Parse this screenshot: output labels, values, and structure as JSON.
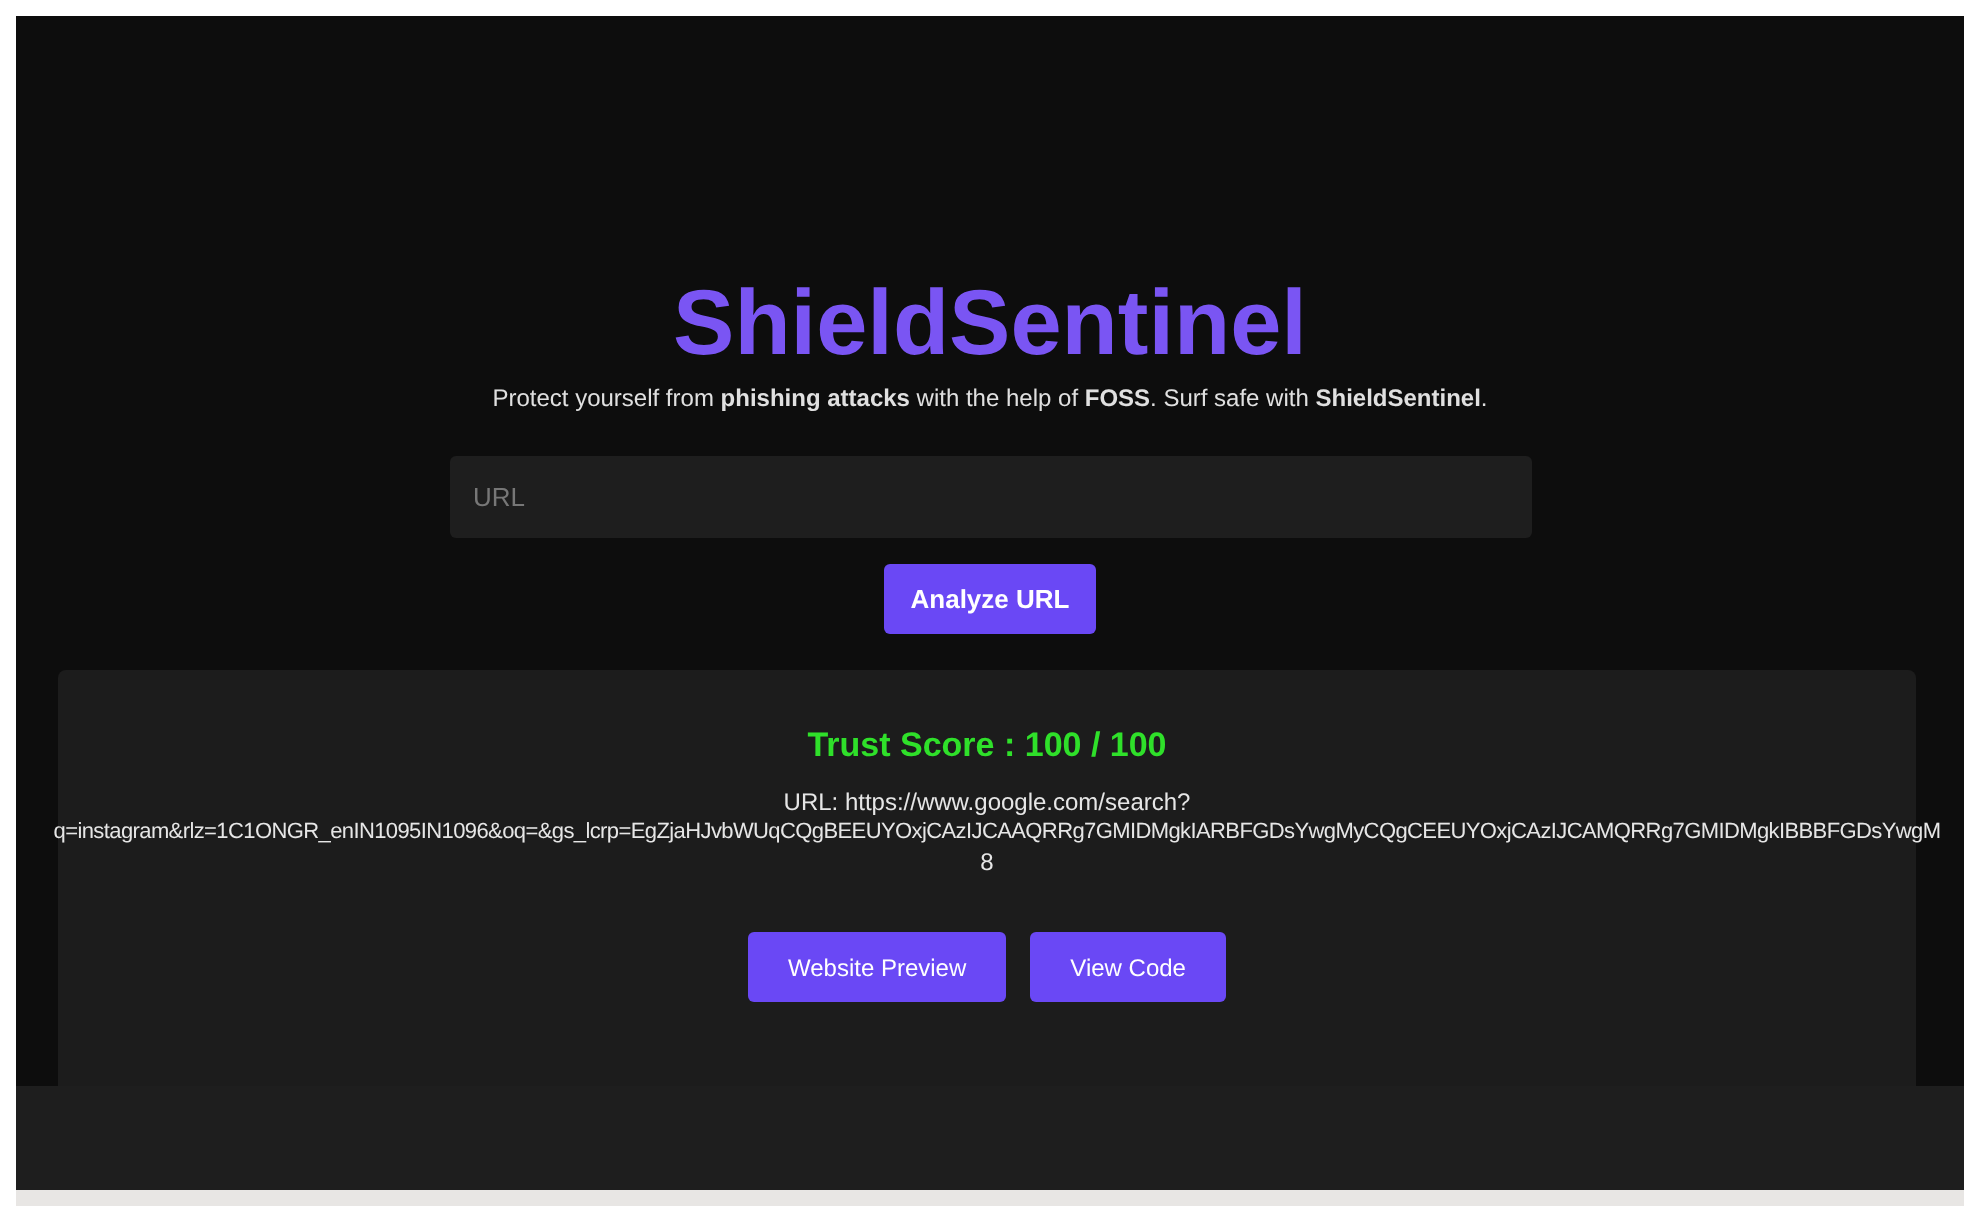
{
  "header": {
    "title": "ShieldSentinel",
    "tagline": "Protect yourself from **phishing attacks** with the help of **FOSS**. Surf safe with **ShieldSentinel**."
  },
  "search": {
    "placeholder": "URL",
    "button": "Analyze URL"
  },
  "result": {
    "score": "Trust Score : 100 / 100",
    "url_lines": [
      "URL: https://www.google.com/search?",
      "q=instagram&rlz=1C1ONGR_enIN1095IN1096&oq=&gs_lcrp=EgZjaHJvbWUqCQgBEEUYOxjCAzIJCAAQRRg7GMIDMgkIARBFGDsYwgMyCQgCEEUYOxjCAzIJCAMQRRg7GMIDMgkIBBBFGDsYwgM",
      "8"
    ],
    "buttons": [
      "Website Preview",
      "View Code"
    ]
  }
}
